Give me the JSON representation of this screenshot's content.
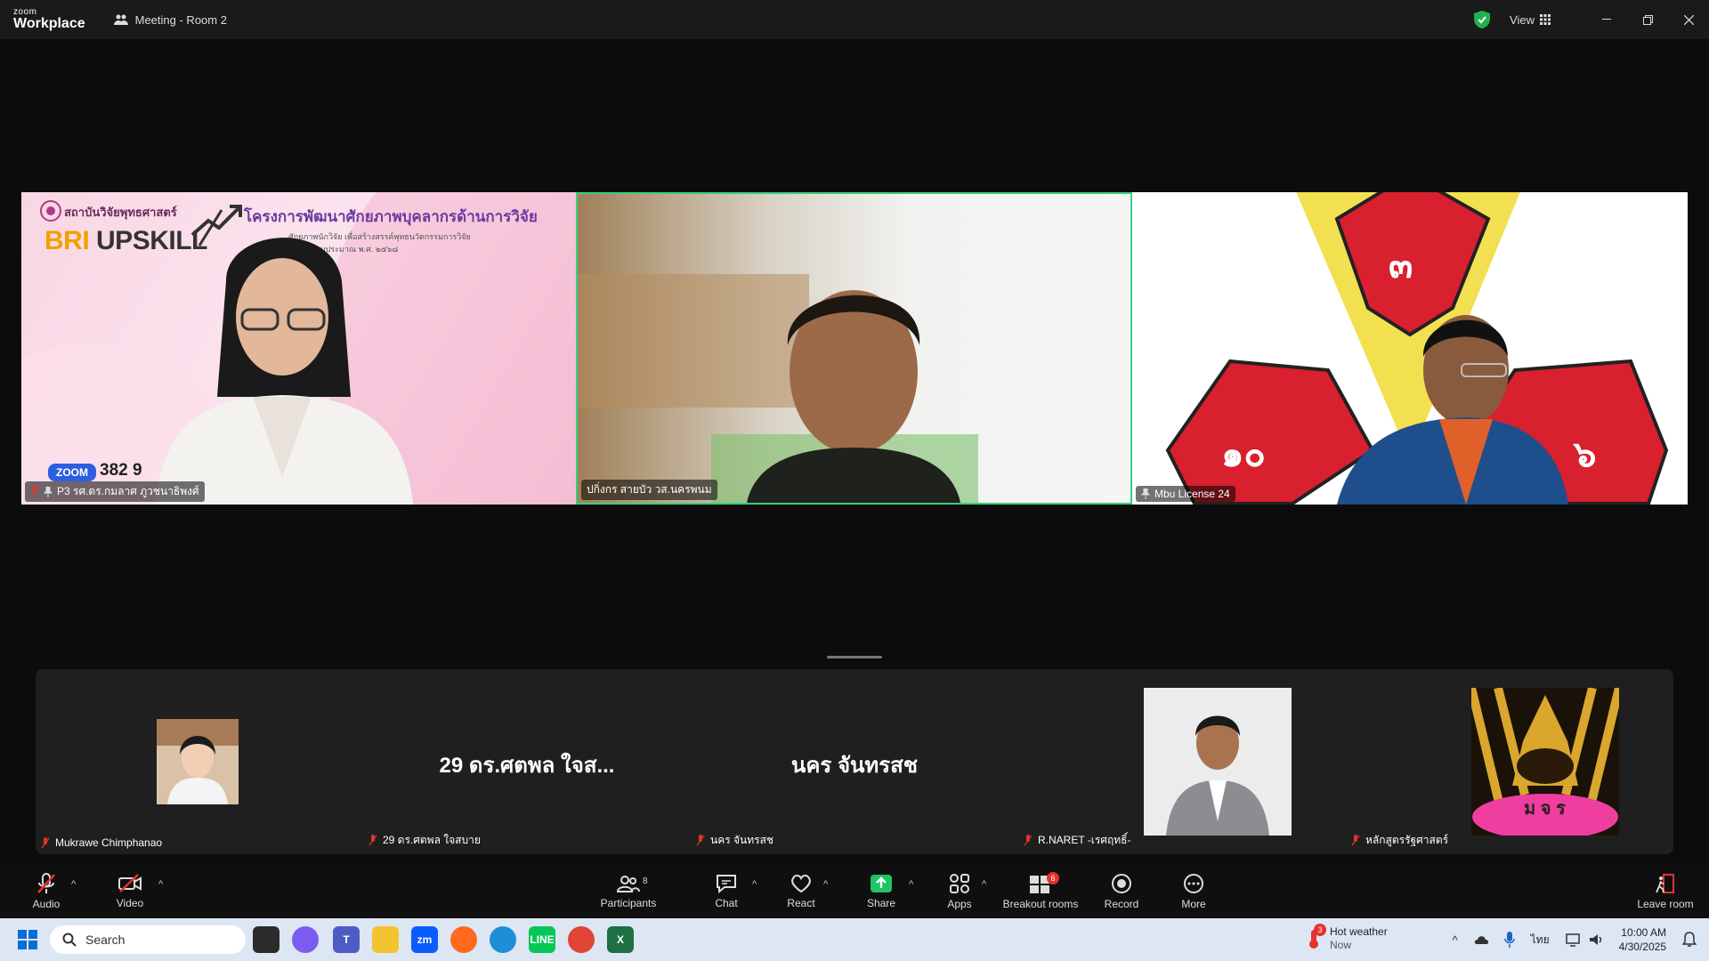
{
  "titlebar": {
    "logo_top": "zoom",
    "logo_bottom": "Workplace",
    "meeting_title": "Meeting - Room 2",
    "view_label": "View"
  },
  "tiles": [
    {
      "label": "P3 รศ.ดร.กมลาศ ภูวชนาธิพงศ์",
      "banner_org": "สถาบันวิจัยพุทธศาสตร์",
      "banner_bri": "BRI",
      "banner_upskill": "UPSKILL",
      "banner_heading": "โครงการพัฒนาศักยภาพบุคลากรด้านการวิจัย",
      "banner_sub1": "ศักยภาพนักวิจัย เพื่อสร้างสรรค์พุทธนวัตกรรมการวิจัย",
      "banner_sub2": "ประจำปีงบประมาณ พ.ศ. ๒๕๖๘",
      "zoom_badge": "ZOOM",
      "zoom_count": "382 9"
    },
    {
      "label": "ปกิ่งกร สายบัว วส.นครพนม"
    },
    {
      "label": "Mbu License 24",
      "emblem_top": "๓",
      "emblem_left": "๑๐",
      "emblem_right": "๖"
    }
  ],
  "participants": [
    {
      "name": "Mukrawe Chimphanao",
      "big_name": ""
    },
    {
      "name": "29 ดร.ศตพล ใจสบาย",
      "big_name": "29 ดร.ศตพล ใจส..."
    },
    {
      "name": "นคร จันทรสช",
      "big_name": "นคร จันทรสช"
    },
    {
      "name": "R.NARET -เรศฤทธิ์-",
      "big_name": ""
    },
    {
      "name": "หลักสูตรรัฐศาสตร์",
      "big_name": "",
      "logo_text": "ม จ ร"
    }
  ],
  "toolbar": {
    "audio": "Audio",
    "video": "Video",
    "participants": "Participants",
    "participants_count": "8",
    "chat": "Chat",
    "react": "React",
    "share": "Share",
    "apps": "Apps",
    "breakout": "Breakout rooms",
    "breakout_count": "6",
    "record": "Record",
    "more": "More",
    "leave": "Leave room"
  },
  "taskbar": {
    "search_placeholder": "Search",
    "weather_title": "Hot weather",
    "weather_sub": "Now",
    "weather_badge": "3",
    "lang": "ไทย",
    "time": "10:00 AM",
    "date": "4/30/2025"
  },
  "colors": {
    "active_speaker_border": "#35d07f",
    "share_green": "#1fc466",
    "mic_off_red": "#e5322d",
    "emblem_red": "#d8202e"
  }
}
